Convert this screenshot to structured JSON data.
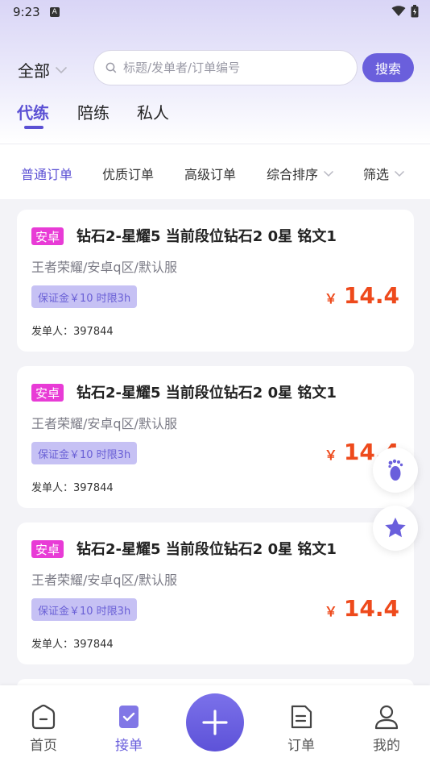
{
  "status_bar": {
    "time": "9:23",
    "notif_glyph": "A"
  },
  "search": {
    "scope": "全部",
    "placeholder": "标题/发单者/订单编号",
    "button": "搜索"
  },
  "main_tabs": [
    {
      "label": "代练",
      "active": true
    },
    {
      "label": "陪练",
      "active": false
    },
    {
      "label": "私人",
      "active": false
    }
  ],
  "filters": [
    {
      "label": "普通订单",
      "active": true
    },
    {
      "label": "优质订单",
      "active": false
    },
    {
      "label": "高级订单",
      "active": false
    },
    {
      "label": "综合排序",
      "active": false
    },
    {
      "label": "筛选",
      "active": false
    }
  ],
  "orders": [
    {
      "platform": "安卓",
      "title": "钻石2-星耀5 当前段位钻石2 0星 铭文1",
      "server": "王者荣耀/安卓q区/默认服",
      "deposit": "保证金￥10 时限3h",
      "price_symbol": "￥",
      "price": "14.4",
      "issuer": "发单人：397844"
    },
    {
      "platform": "安卓",
      "title": "钻石2-星耀5 当前段位钻石2 0星 铭文1",
      "server": "王者荣耀/安卓q区/默认服",
      "deposit": "保证金￥10 时限3h",
      "price_symbol": "￥",
      "price": "14.4",
      "issuer": "发单人：397844"
    },
    {
      "platform": "安卓",
      "title": "钻石2-星耀5 当前段位钻石2 0星 铭文1",
      "server": "王者荣耀/安卓q区/默认服",
      "deposit": "保证金￥10 时限3h",
      "price_symbol": "￥",
      "price": "14.4",
      "issuer": "发单人：397844"
    }
  ],
  "bottom_nav": [
    {
      "label": "首页",
      "icon": "home-icon",
      "active": false
    },
    {
      "label": "接单",
      "icon": "take-order-icon",
      "active": true
    },
    {
      "label": "订单",
      "icon": "order-list-icon",
      "active": false
    },
    {
      "label": "我的",
      "icon": "profile-icon",
      "active": false
    }
  ],
  "colors": {
    "accent": "#5b50d4",
    "badge": "#e83bd6",
    "price": "#ee4a1c",
    "tag_bg": "#c6c1f4"
  }
}
